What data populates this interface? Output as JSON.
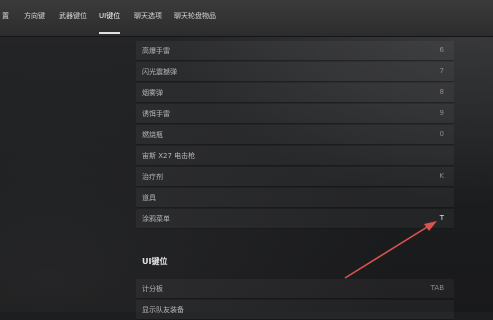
{
  "tabs": [
    {
      "label": "置"
    },
    {
      "label": "方向键"
    },
    {
      "label": "武器键位"
    },
    {
      "label": "UI键位"
    },
    {
      "label": "聊天选项"
    },
    {
      "label": "聊天轮盘物品"
    }
  ],
  "rows": [
    {
      "label": "高爆手雷",
      "key": "6"
    },
    {
      "label": "闪光震撼弹",
      "key": "7"
    },
    {
      "label": "烟雾弹",
      "key": "8"
    },
    {
      "label": "诱饵手雷",
      "key": "9"
    },
    {
      "label": "燃烧瓶",
      "key": "0"
    },
    {
      "label": "宙斯 X27 电击枪",
      "key": ""
    },
    {
      "label": "治疗剂",
      "key": "K"
    },
    {
      "label": "道具",
      "key": ""
    },
    {
      "label": "涂鸦菜单",
      "key": "T"
    }
  ],
  "ui_section": {
    "title": "UI键位",
    "rows": [
      {
        "label": "计分板",
        "key": "TAB"
      },
      {
        "label": "显示队友装备",
        "key": ""
      }
    ]
  },
  "colors": {
    "arrow": "#d9534f",
    "accent": "#e0e0e0"
  }
}
